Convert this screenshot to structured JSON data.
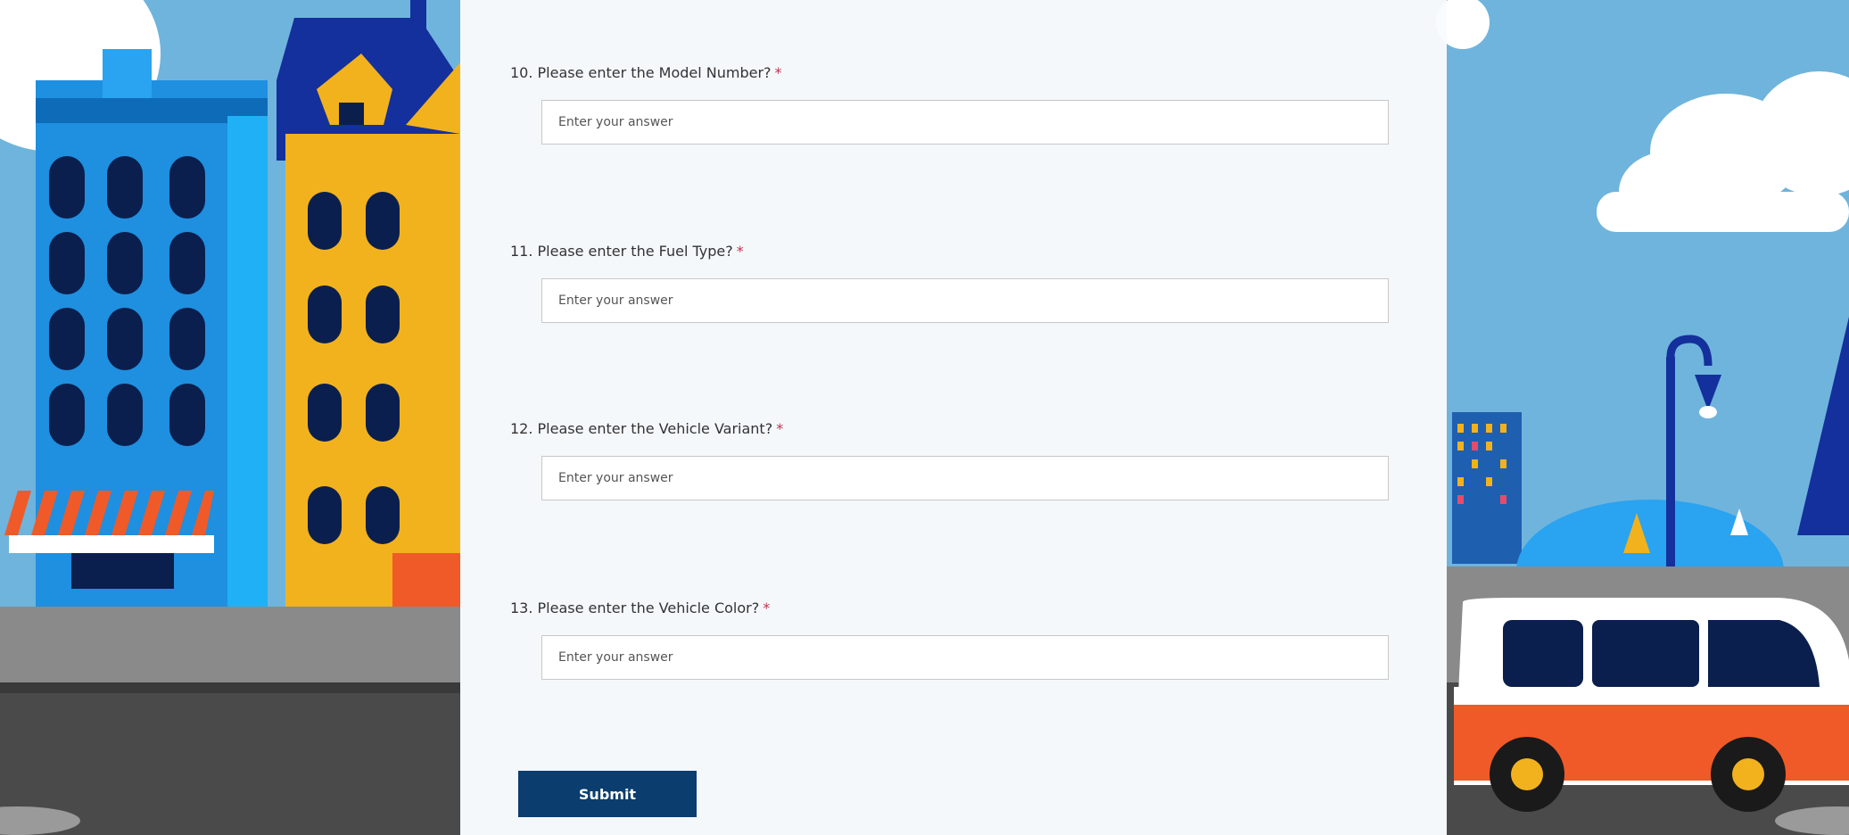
{
  "form": {
    "questions": [
      {
        "label": "10. Please enter the Model Number?",
        "required_mark": "*",
        "placeholder": "Enter your answer",
        "value": ""
      },
      {
        "label": "11. Please enter the Fuel Type?",
        "required_mark": "*",
        "placeholder": "Enter your answer",
        "value": ""
      },
      {
        "label": "12. Please enter the Vehicle Variant?",
        "required_mark": "*",
        "placeholder": "Enter your answer",
        "value": ""
      },
      {
        "label": "13. Please enter the Vehicle Color?",
        "required_mark": "*",
        "placeholder": "Enter your answer",
        "value": ""
      }
    ],
    "submit_label": "Submit"
  },
  "colors": {
    "sky": "#6fb4dc",
    "submit": "#0b3d6e",
    "required": "#c4314b"
  }
}
